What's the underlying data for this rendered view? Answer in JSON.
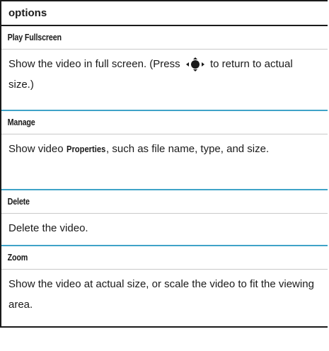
{
  "header": {
    "title": "options"
  },
  "rows": [
    {
      "title": "Play Fullscreen",
      "desc_before": "Show the video in full screen. (Press ",
      "icon": "nav-key-icon",
      "desc_after": " to return to actual size.)"
    },
    {
      "title": "Manage",
      "desc_before": "Show video ",
      "keyword": "Properties",
      "desc_after": ", such as file name, type, and size."
    },
    {
      "title": "Delete",
      "desc": "Delete the video."
    },
    {
      "title": "Zoom",
      "desc": "Show the video at actual size, or scale the video to fit the viewing area."
    }
  ],
  "colors": {
    "divider_accent": "#3fa3c8",
    "border": "#1a1a1a"
  }
}
